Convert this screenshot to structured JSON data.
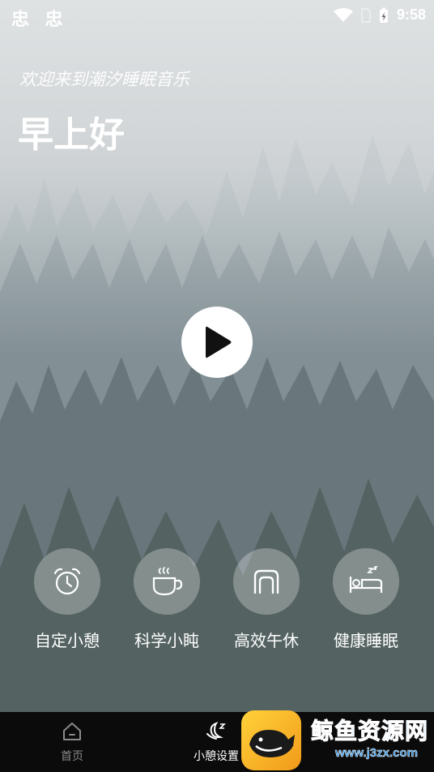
{
  "status_bar": {
    "left_icons": "忠 忠",
    "time": "9:58"
  },
  "header": {
    "welcome": "欢迎来到潮汐睡眠音乐",
    "greeting": "早上好"
  },
  "features": [
    {
      "label": "自定小憩",
      "icon": "alarm-clock-icon"
    },
    {
      "label": "科学小盹",
      "icon": "coffee-cup-icon"
    },
    {
      "label": "高效午休",
      "icon": "pillow-icon"
    },
    {
      "label": "健康睡眠",
      "icon": "bed-sleep-icon"
    }
  ],
  "tabs": [
    {
      "label": "首页",
      "icon": "home-icon",
      "active": false
    },
    {
      "label": "小憩设置",
      "icon": "moon-nap-icon",
      "active": true
    }
  ],
  "watermark": {
    "title": "鲸鱼资源网",
    "url": "www.j3zx.com"
  },
  "colors": {
    "tab_bar": "#0b0b0b",
    "feature_circle": "rgba(255,255,255,0.28)",
    "watermark_blue": "#2e8fe0",
    "watermark_logo": "#f5b52a"
  }
}
